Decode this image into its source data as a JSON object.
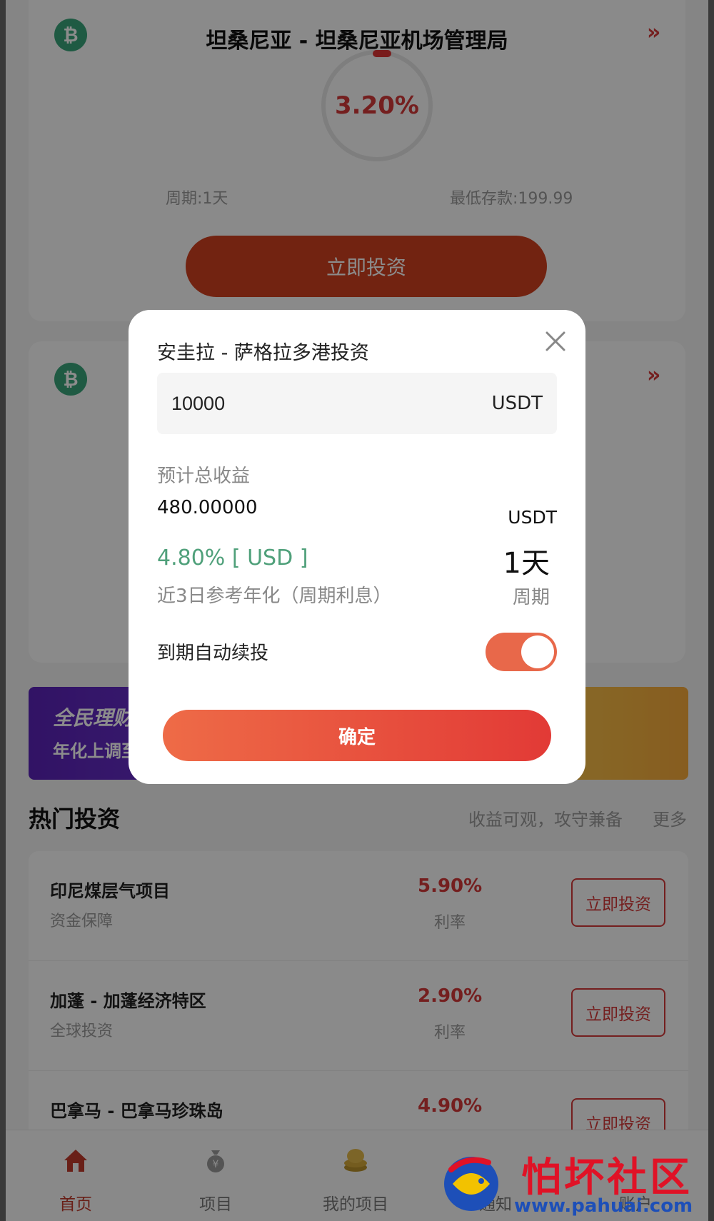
{
  "card1": {
    "title": "坦桑尼亚 - 坦桑尼亚机场管理局",
    "rate": "3.20%",
    "period": "周期:1天",
    "min_deposit": "最低存款:199.99",
    "button": "立即投资"
  },
  "card2": {},
  "banner": {
    "line1": "全民理财",
    "line2": "年化上调至"
  },
  "section": {
    "title": "热门投资",
    "subtitle": "收益可观，攻守兼备",
    "more": "更多"
  },
  "hot_list": [
    {
      "name": "印尼煤层气项目",
      "tag": "资金保障",
      "rate": "5.90%",
      "rate_label": "利率",
      "button": "立即投资"
    },
    {
      "name": "加蓬 - 加蓬经济特区",
      "tag": "全球投资",
      "rate": "2.90%",
      "rate_label": "利率",
      "button": "立即投资"
    },
    {
      "name": "巴拿马 - 巴拿马珍珠岛",
      "tag": "",
      "rate": "4.90%",
      "rate_label": "",
      "button": "立即投资"
    }
  ],
  "tabbar": [
    {
      "label": "首页",
      "icon": "home-icon",
      "active": true
    },
    {
      "label": "项目",
      "icon": "moneybag-icon",
      "active": false
    },
    {
      "label": "我的项目",
      "icon": "coins-icon",
      "active": false
    },
    {
      "label": "通知",
      "icon": "notice-icon",
      "active": false
    },
    {
      "label": "账户",
      "icon": "account-icon",
      "active": false
    }
  ],
  "modal": {
    "title": "安圭拉 - 萨格拉多港投资",
    "amount": "10000",
    "amount_unit": "USDT",
    "est_label": "预计总收益",
    "est_value": "480.00000",
    "est_unit": "USDT",
    "rate": "4.80% [ USD ]",
    "rate_desc": "近3日参考年化（周期利息）",
    "period_value": "1天",
    "period_label": "周期",
    "auto_renew_label": "到期自动续投",
    "auto_renew_on": true,
    "confirm": "确定"
  },
  "watermark": {
    "title": "怕坏社区",
    "url": "www.pahuai.com"
  },
  "colors": {
    "accent_red": "#d43a3a",
    "green_rate": "#4fa07a",
    "btc_green": "#3aa57a"
  }
}
